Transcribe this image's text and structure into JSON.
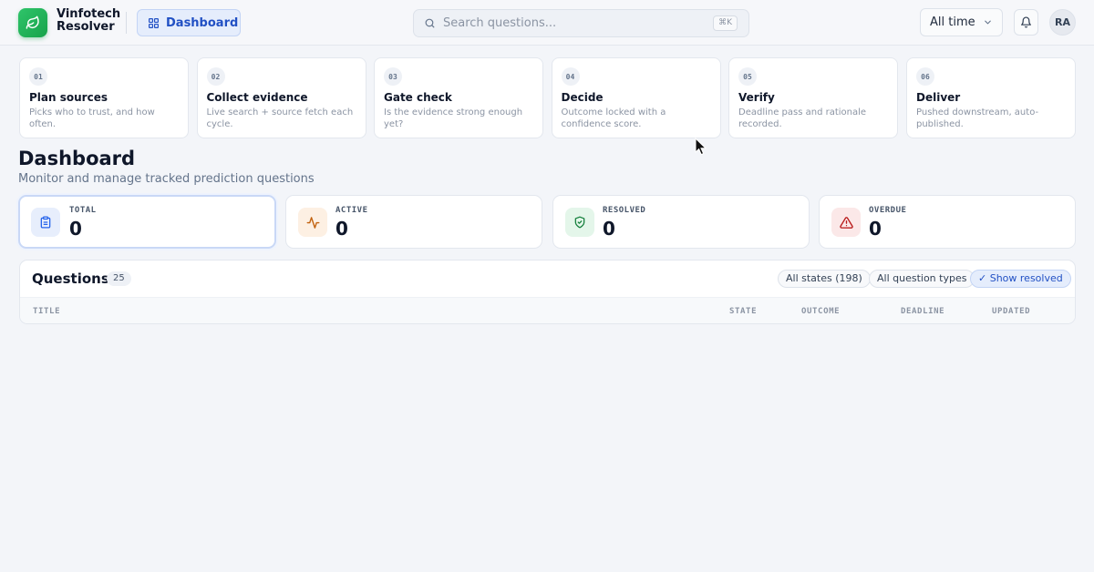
{
  "app": {
    "name_line1": "Vinfotech",
    "name_line2": "Resolver"
  },
  "nav": {
    "dashboard_label": "Dashboard"
  },
  "search": {
    "placeholder": "Search questions...",
    "shortcut": "⌘K"
  },
  "time_range": {
    "selected": "All time"
  },
  "user": {
    "initials": "RA"
  },
  "steps": [
    {
      "num": "01",
      "title": "Plan sources",
      "desc": "Picks who to trust, and how often."
    },
    {
      "num": "02",
      "title": "Collect evidence",
      "desc": "Live search + source fetch each cycle."
    },
    {
      "num": "03",
      "title": "Gate check",
      "desc": "Is the evidence strong enough yet?"
    },
    {
      "num": "04",
      "title": "Decide",
      "desc": "Outcome locked with a confidence score."
    },
    {
      "num": "05",
      "title": "Verify",
      "desc": "Deadline pass and rationale recorded."
    },
    {
      "num": "06",
      "title": "Deliver",
      "desc": "Pushed downstream, auto-published."
    }
  ],
  "page": {
    "title": "Dashboard",
    "subtitle": "Monitor and manage tracked prediction questions"
  },
  "stats": [
    {
      "label": "TOTAL",
      "value": "0",
      "icon": "clipboard-icon",
      "color": "#2563eb"
    },
    {
      "label": "ACTIVE",
      "value": "0",
      "icon": "activity-icon",
      "color": "#c2620f"
    },
    {
      "label": "RESOLVED",
      "value": "0",
      "icon": "shield-check-icon",
      "color": "#15803d"
    },
    {
      "label": "OVERDUE",
      "value": "0",
      "icon": "alert-triangle-icon",
      "color": "#b91c1c"
    }
  ],
  "questions": {
    "title": "Questions",
    "count": "25",
    "filters": {
      "states": "All states (198)",
      "types": "All question types",
      "show_resolved": "✓ Show resolved"
    },
    "columns": {
      "title": "TITLE",
      "state": "STATE",
      "outcome": "OUTCOME",
      "deadline": "DEADLINE",
      "updated": "UPDATED"
    }
  }
}
